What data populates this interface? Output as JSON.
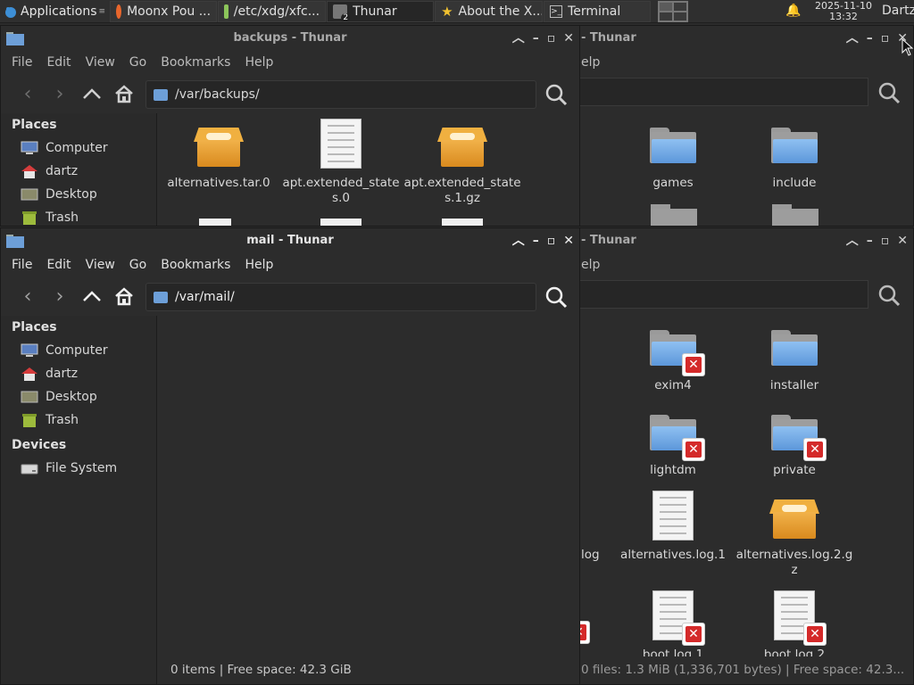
{
  "panel": {
    "app_menu": "Applications",
    "tasks": [
      {
        "label": "Moonx Pou ...",
        "icon": "firefox-icon"
      },
      {
        "label": "/etc/xdg/xfc...",
        "icon": "text-editor-icon"
      },
      {
        "label": "Thunar",
        "icon": "file-manager-icon",
        "count": "2"
      },
      {
        "label": "About the X...",
        "icon": "star-icon"
      },
      {
        "label": "Terminal",
        "icon": "terminal-icon"
      }
    ],
    "clock_date": "2025-11-10",
    "clock_time": "13:32",
    "user": "Dartz"
  },
  "menus": [
    "File",
    "Edit",
    "View",
    "Go",
    "Bookmarks",
    "Help"
  ],
  "win_backups": {
    "title": "backups - Thunar",
    "path": "/var/backups/",
    "files": [
      {
        "name": "alternatives.tar.0",
        "type": "archive"
      },
      {
        "name": "apt.extended_states.0",
        "type": "document"
      },
      {
        "name": "apt.extended_states.1.gz",
        "type": "archive"
      }
    ]
  },
  "win_mail": {
    "title": "mail - Thunar",
    "path": "/var/mail/",
    "status": "0 items  |  Free space: 42.3 GiB"
  },
  "sidebar": {
    "places_heading": "Places",
    "places": [
      "Computer",
      "dartz",
      "Desktop",
      "Trash"
    ],
    "devices_heading": "Devices",
    "devices": [
      "File System"
    ]
  },
  "win_right_top": {
    "title_fragment": "- Thunar",
    "menu_fragment": "elp",
    "files": [
      {
        "name": "games",
        "type": "folder"
      },
      {
        "name": "include",
        "type": "folder"
      }
    ]
  },
  "win_right_bottom": {
    "title_fragment": "- Thunar",
    "menu_fragment": "elp",
    "files": [
      {
        "name": "exim4",
        "type": "folder",
        "locked": true
      },
      {
        "name": "installer",
        "type": "folder",
        "locked": false
      },
      {
        "name": "lightdm",
        "type": "folder",
        "locked": true
      },
      {
        "name": "private",
        "type": "folder",
        "locked": true
      },
      {
        "name": "alternatives.log.1",
        "type": "document",
        "locked": false
      },
      {
        "name": "alternatives.log.2.gz",
        "type": "archive",
        "locked": false
      },
      {
        "name": "boot.log.1",
        "type": "document",
        "locked": true
      },
      {
        "name": "boot.log.2",
        "type": "document",
        "locked": true
      }
    ],
    "clipped_name": "log",
    "status": "0 files: 1.3 MiB (1,336,701 bytes)  |  Free space: 42.3..."
  },
  "colors": {
    "accent_folder": "#5c97da",
    "badge": "#d42a2a"
  }
}
